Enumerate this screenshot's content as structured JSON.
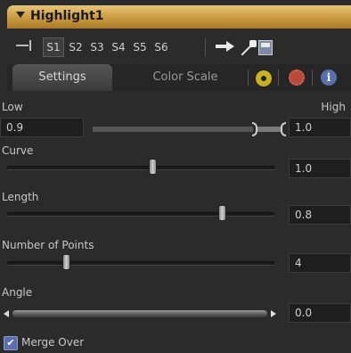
{
  "header": {
    "title": "Highlight1"
  },
  "toolbar": {
    "slots": [
      "S1",
      "S2",
      "S3",
      "S4",
      "S5",
      "S6"
    ],
    "active_slot": "S1"
  },
  "tabs": [
    {
      "label": "Settings",
      "active": true
    },
    {
      "label": "Color Scale",
      "active": false
    }
  ],
  "tab_icons": [
    "radiation-icon",
    "gear-icon",
    "info-icon"
  ],
  "controls": {
    "low": {
      "label": "Low",
      "value": "0.9"
    },
    "high": {
      "label": "High",
      "value": "1.0"
    },
    "curve": {
      "label": "Curve",
      "value": "1.0",
      "fraction": 0.42
    },
    "length": {
      "label": "Length",
      "value": "0.8",
      "fraction": 0.73
    },
    "points": {
      "label": "Number of Points",
      "value": "4",
      "fraction": 0.18
    },
    "angle": {
      "label": "Angle",
      "value": "0.0"
    },
    "merge_over": {
      "label": "Merge Over",
      "checked": true
    }
  },
  "colors": {
    "header_gold": "#c99a3e",
    "checkbox_blue": "#5a6fae"
  }
}
